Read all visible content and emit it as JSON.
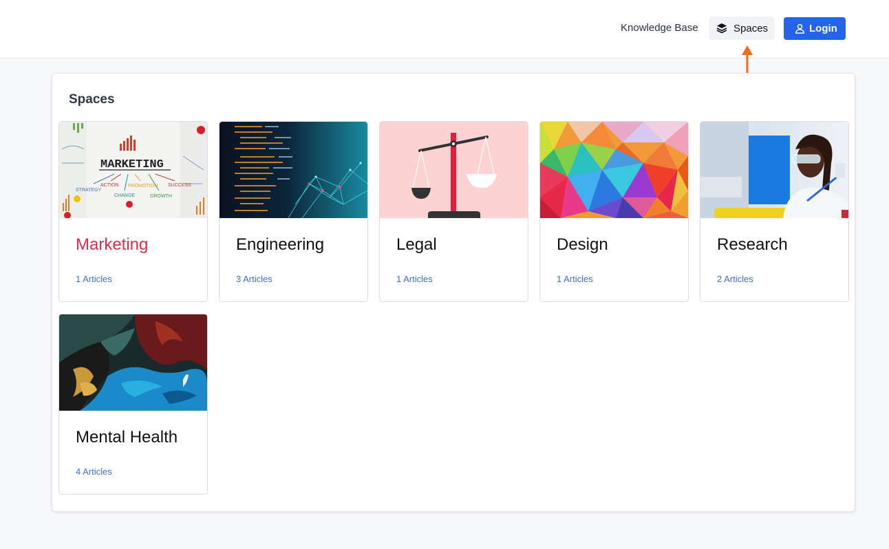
{
  "header": {
    "nav_link": "Knowledge Base",
    "spaces_label": "Spaces",
    "login_label": "Login",
    "accent_color": "#2563eb",
    "annotation_color": "#f26a1b"
  },
  "main": {
    "title": "Spaces",
    "cards": [
      {
        "name": "Marketing",
        "count": "1 Articles",
        "image": "marketing-board-image",
        "active": true
      },
      {
        "name": "Engineering",
        "count": "3 Articles",
        "image": "code-screen-image",
        "active": false
      },
      {
        "name": "Legal",
        "count": "1 Articles",
        "image": "justice-scale-image",
        "active": false
      },
      {
        "name": "Design",
        "count": "1 Articles",
        "image": "low-poly-pattern-image",
        "active": false
      },
      {
        "name": "Research",
        "count": "2 Articles",
        "image": "lab-scientist-image",
        "active": false
      },
      {
        "name": "Mental Health",
        "count": "4 Articles",
        "image": "fluid-art-image",
        "active": false
      }
    ],
    "marketing_image_text": {
      "title": "MARKETING",
      "terms": [
        "STRATEGY",
        "ACTION",
        "PROMOTION",
        "SUCCESS",
        "CHANGE",
        "GROWTH"
      ]
    }
  }
}
